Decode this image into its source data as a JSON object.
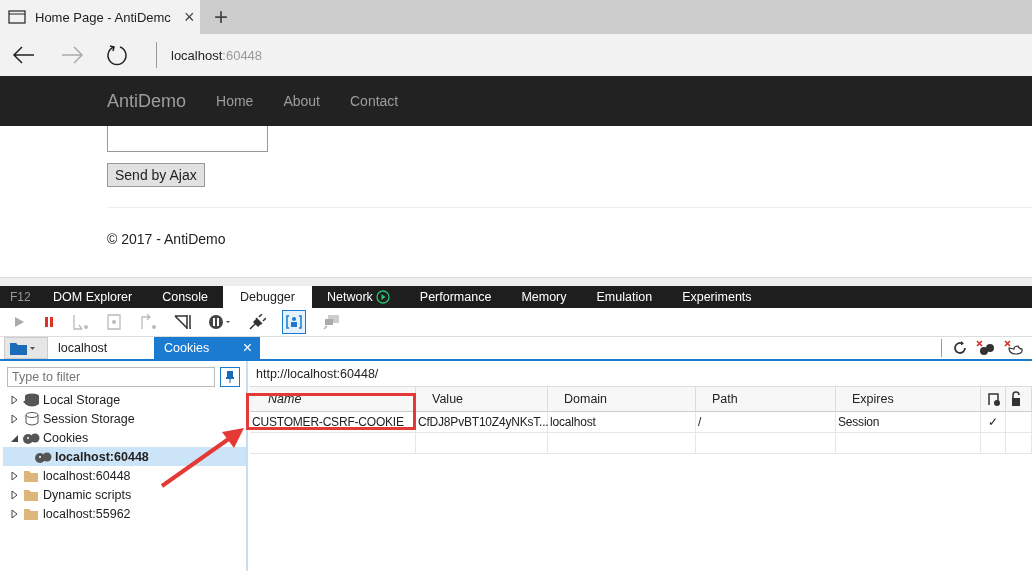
{
  "browser": {
    "tab_title": "Home Page - AntiDemc",
    "close": "×",
    "new_tab": "+",
    "address_host": "localhost",
    "address_port": ":60448"
  },
  "navbar": {
    "brand": "AntiDemo",
    "links": [
      "Home",
      "About",
      "Contact"
    ]
  },
  "page": {
    "button": "Send by Ajax",
    "footer": "© 2017 - AntiDemo"
  },
  "devtools": {
    "f12": "F12",
    "tabs": [
      {
        "label": "DOM Explorer",
        "selected": false
      },
      {
        "label": "Console",
        "selected": false
      },
      {
        "label": "Debugger",
        "selected": true
      },
      {
        "label": "Network",
        "selected": false
      },
      {
        "label": "Performance",
        "selected": false
      },
      {
        "label": "Memory",
        "selected": false
      },
      {
        "label": "Emulation",
        "selected": false
      },
      {
        "label": "Experiments",
        "selected": false
      }
    ],
    "doc_tabs": [
      {
        "label": "localhost",
        "selected": false
      },
      {
        "label": "Cookies",
        "selected": true,
        "close": "×"
      }
    ],
    "filter": {
      "placeholder": "Type to filter"
    },
    "tree": [
      {
        "label": "Local Storage",
        "kind": "local-storage",
        "expanded": false,
        "selected": false
      },
      {
        "label": "Session Storage",
        "kind": "session-storage",
        "expanded": false,
        "selected": false
      },
      {
        "label": "Cookies",
        "kind": "cookies",
        "expanded": true,
        "selected": false,
        "children": [
          {
            "label": "localhost:60448",
            "kind": "cookies",
            "selected": true
          }
        ]
      },
      {
        "label": "localhost:60448",
        "kind": "folder",
        "expanded": false,
        "selected": false
      },
      {
        "label": "Dynamic scripts",
        "kind": "folder",
        "expanded": false,
        "selected": false
      },
      {
        "label": "localhost:55962",
        "kind": "folder",
        "expanded": false,
        "selected": false
      }
    ],
    "url": "http://localhost:60448/",
    "table": {
      "columns": [
        "Name",
        "Value",
        "Domain",
        "Path",
        "Expires"
      ],
      "rows": [
        {
          "name": "CUSTOMER-CSRF-COOKIE",
          "value": "CfDJ8PvBT10Z4yNKsT...",
          "domain": "localhost",
          "path": "/",
          "expires": "Session",
          "http_only": "✓"
        }
      ]
    }
  }
}
